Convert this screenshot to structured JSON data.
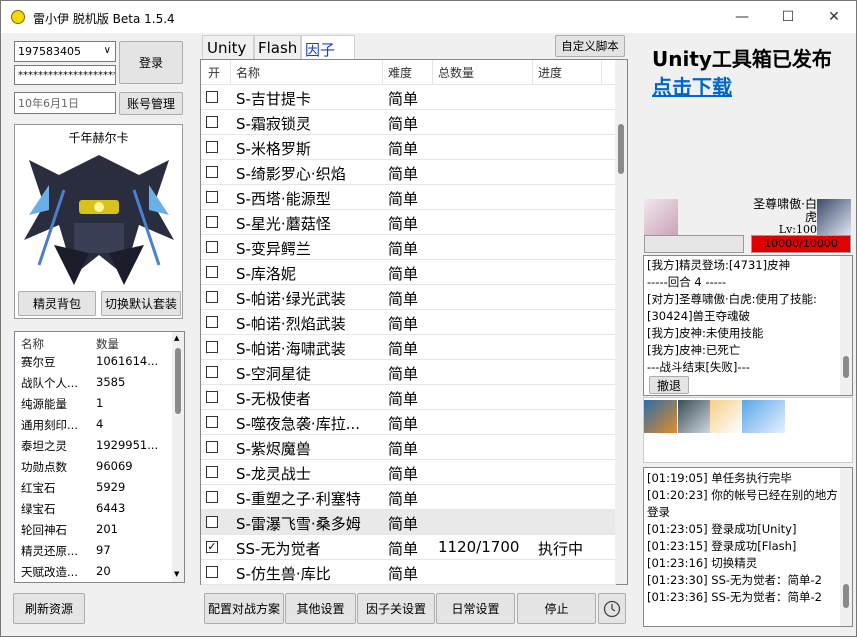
{
  "window": {
    "title": "雷小伊 脱机版 Beta 1.5.4"
  },
  "login": {
    "account": "197583405",
    "password": "****************************",
    "date": "10年6月1日",
    "login_button": "登录",
    "account_button": "账号管理"
  },
  "pet": {
    "name": "千年赫尔卡",
    "bag_button": "精灵背包",
    "switch_button": "切换默认套装"
  },
  "inventory": {
    "headers": [
      "名称",
      "数量"
    ],
    "rows": [
      [
        "赛尔豆",
        "1061614..."
      ],
      [
        "战队个人...",
        "3585"
      ],
      [
        "纯源能量",
        "1"
      ],
      [
        "通用刻印...",
        "4"
      ],
      [
        "泰坦之灵",
        "1929951..."
      ],
      [
        "功勋点数",
        "96069"
      ],
      [
        "红宝石",
        "5929"
      ],
      [
        "绿宝石",
        "6443"
      ],
      [
        "轮回神石",
        "201"
      ],
      [
        "精灵还原...",
        "97"
      ],
      [
        "天赋改造...",
        "20"
      ]
    ],
    "refresh_button": "刷新资源"
  },
  "tabs": [
    "Unity",
    "Flash",
    "因子"
  ],
  "custom_script_button": "自定义脚本",
  "task_table": {
    "headers": [
      "开",
      "名称",
      "难度",
      "总数量",
      "进度"
    ],
    "rows": [
      {
        "checked": false,
        "name": "S-吉甘提卡",
        "difficulty": "简单",
        "total": "",
        "progress": ""
      },
      {
        "checked": false,
        "name": "S-霜寂锁灵",
        "difficulty": "简单",
        "total": "",
        "progress": ""
      },
      {
        "checked": false,
        "name": "S-米格罗斯",
        "difficulty": "简单",
        "total": "",
        "progress": ""
      },
      {
        "checked": false,
        "name": "S-绮影罗心·织焰",
        "difficulty": "简单",
        "total": "",
        "progress": ""
      },
      {
        "checked": false,
        "name": "S-西塔·能源型",
        "difficulty": "简单",
        "total": "",
        "progress": ""
      },
      {
        "checked": false,
        "name": "S-星光·蘑菇怪",
        "difficulty": "简单",
        "total": "",
        "progress": ""
      },
      {
        "checked": false,
        "name": "S-变异鳄兰",
        "difficulty": "简单",
        "total": "",
        "progress": ""
      },
      {
        "checked": false,
        "name": "S-库洛妮",
        "difficulty": "简单",
        "total": "",
        "progress": ""
      },
      {
        "checked": false,
        "name": "S-帕诺·绿光武装",
        "difficulty": "简单",
        "total": "",
        "progress": ""
      },
      {
        "checked": false,
        "name": "S-帕诺·烈焰武装",
        "difficulty": "简单",
        "total": "",
        "progress": ""
      },
      {
        "checked": false,
        "name": "S-帕诺·海啸武装",
        "difficulty": "简单",
        "total": "",
        "progress": ""
      },
      {
        "checked": false,
        "name": "S-空洞星徒",
        "difficulty": "简单",
        "total": "",
        "progress": ""
      },
      {
        "checked": false,
        "name": "S-无极使者",
        "difficulty": "简单",
        "total": "",
        "progress": ""
      },
      {
        "checked": false,
        "name": "S-噬夜急袭·库拉...",
        "difficulty": "简单",
        "total": "",
        "progress": ""
      },
      {
        "checked": false,
        "name": "S-紫烬魔兽",
        "difficulty": "简单",
        "total": "",
        "progress": ""
      },
      {
        "checked": false,
        "name": "S-龙灵战士",
        "difficulty": "简单",
        "total": "",
        "progress": ""
      },
      {
        "checked": false,
        "name": "S-重塑之子·利塞特",
        "difficulty": "简单",
        "total": "",
        "progress": ""
      },
      {
        "checked": false,
        "name": "S-雷瀑飞雪·桑多姆",
        "difficulty": "简单",
        "total": "",
        "progress": ""
      },
      {
        "checked": true,
        "name": "SS-无为觉者",
        "difficulty": "简单",
        "total": "1120/1700",
        "progress": "执行中"
      },
      {
        "checked": false,
        "name": "S-仿生兽·库比",
        "difficulty": "简单",
        "total": "",
        "progress": ""
      }
    ]
  },
  "bottom_buttons": [
    "配置对战方案",
    "其他设置",
    "因子关设置",
    "日常设置",
    "停止"
  ],
  "promo": {
    "line1": "Unity工具箱已发布",
    "line2": "点击下载"
  },
  "battle": {
    "enemy_name": "圣尊啸傲·白虎",
    "enemy_level": "Lv:100",
    "enemy_hp": "10000/10000",
    "log": [
      "[我方]精灵登场:[4731]皮神",
      "-----回合 4 -----",
      "[对方]圣尊啸傲·白虎:使用了技能:",
      "[30424]兽王夺魂破",
      "[我方]皮神:未使用技能",
      "[我方]皮神:已死亡",
      "---战斗结束[失败]---"
    ],
    "undo_button": "撤退"
  },
  "system_log": [
    "[01:19:05] 单任务执行完毕",
    "[01:20:23] 你的帐号已经在别的地方",
    "登录",
    "[01:23:05] 登录成功[Unity]",
    "[01:23:15] 登录成功[Flash]",
    "[01:23:16] 切换精灵",
    "[01:23:30] SS-无为觉者：简单-2",
    "[01:23:36] SS-无为觉者：简单-2"
  ],
  "colors": {
    "accent_blue": "#0066cc",
    "hp_red": "#e00000"
  }
}
